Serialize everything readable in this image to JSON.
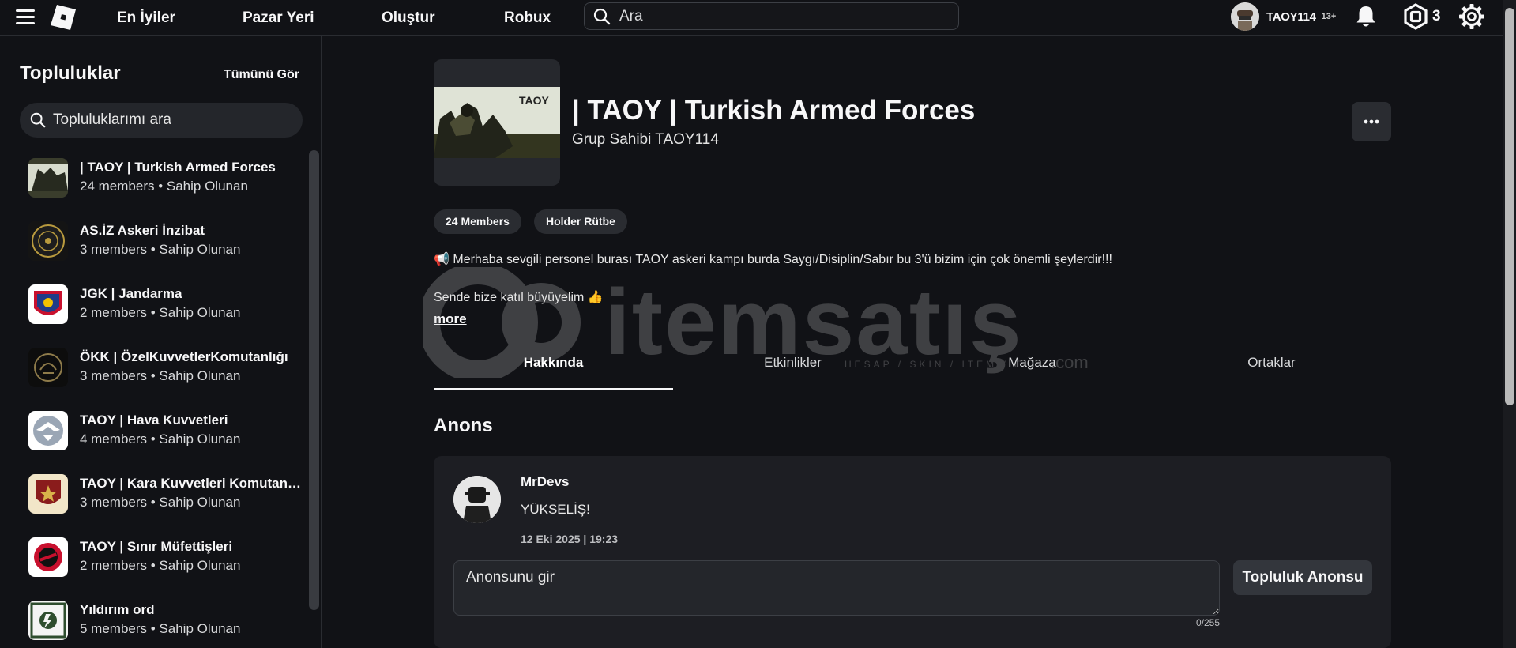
{
  "nav": {
    "links": [
      "En İyiler",
      "Pazar Yeri",
      "Oluştur",
      "Robux"
    ],
    "search_placeholder": "Ara",
    "username": "TAOY114",
    "age_badge": "13+",
    "robux": "3"
  },
  "sidebar": {
    "title": "Topluluklar",
    "see_all": "Tümünü Gör",
    "search_placeholder": "Topluluklarımı ara",
    "groups": [
      {
        "name": "| TAOY | Turkish Armed Forces",
        "meta": "24 members • Sahip Olunan"
      },
      {
        "name": "AS.İZ Askeri İnzibat",
        "meta": "3 members • Sahip Olunan"
      },
      {
        "name": "JGK | Jandarma",
        "meta": "2 members • Sahip Olunan"
      },
      {
        "name": "ÖKK | ÖzelKuvvetlerKomutanlığı",
        "meta": "3 members • Sahip Olunan"
      },
      {
        "name": "TAOY | Hava Kuvvetleri",
        "meta": "4 members • Sahip Olunan"
      },
      {
        "name": "TAOY | Kara Kuvvetleri Komutanlığı",
        "meta": "3 members • Sahip Olunan"
      },
      {
        "name": "TAOY | Sınır Müfettişleri",
        "meta": "2 members • Sahip Olunan"
      },
      {
        "name": "Yıldırım ord",
        "meta": "5 members • Sahip Olunan"
      }
    ]
  },
  "group": {
    "icon_text": "TAOY",
    "title": "| TAOY | Turkish Armed Forces",
    "owner": "Grup Sahibi TAOY114",
    "chips": [
      "24 Members",
      "Holder Rütbe"
    ],
    "description": [
      "📢 Merhaba sevgili personel burası TAOY askeri kampı burda Saygı/Disiplin/Sabır bu 3'ü bizim  için çok önemli şeylerdir!!!",
      "Sende bize katıl büyüyelim 👍"
    ],
    "more": "more"
  },
  "tabs": [
    "Hakkında",
    "Etkinlikler",
    "Mağaza",
    "Ortaklar"
  ],
  "active_tab": "Hakkında",
  "announcement": {
    "section_title": "Anons",
    "poster": "MrDevs",
    "text": "YÜKSELİŞ!",
    "date": "12 Eki 2025 | 19:23",
    "input_placeholder": "Anonsunu gir",
    "char_count": "0/255",
    "button": "Topluluk Anonsu"
  },
  "watermark": {
    "text": "itemsatış",
    "sub": "HESAP / SKIN / ITEM / E",
    "com": ".com"
  },
  "colors": {
    "background": "#111216",
    "card": "#1d1e23",
    "chip": "#2a2c31",
    "text": "#f7f7f8"
  }
}
